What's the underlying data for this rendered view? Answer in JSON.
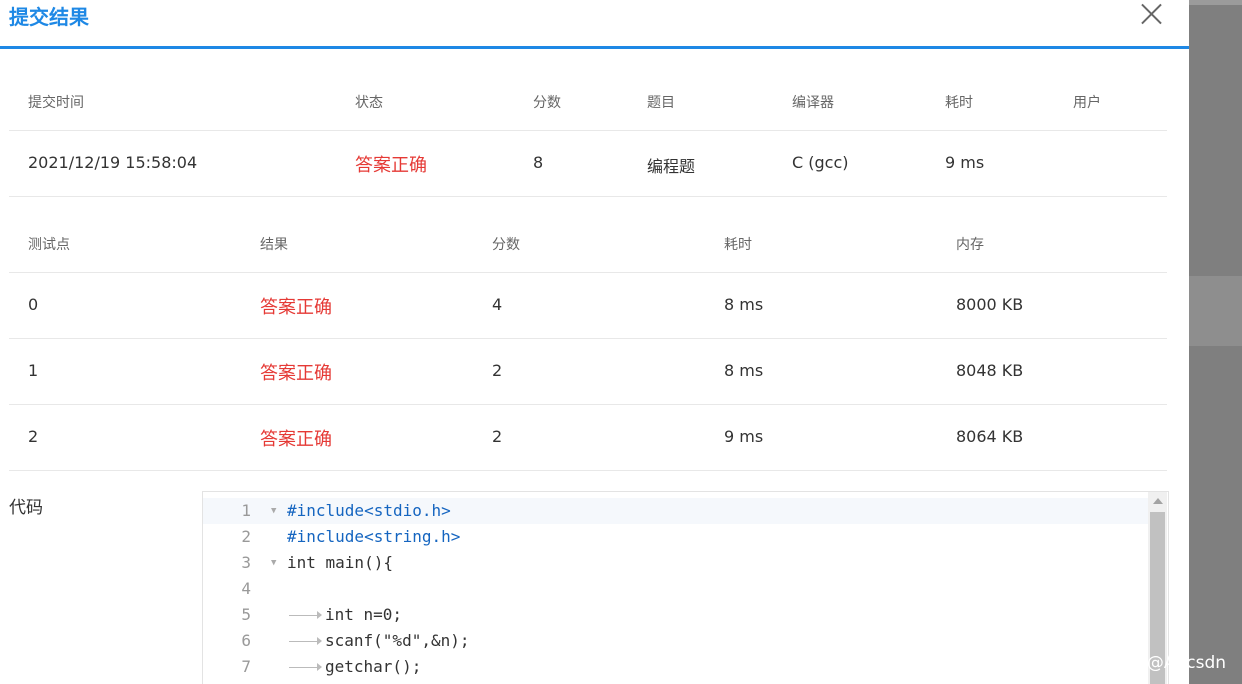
{
  "modal": {
    "title": "提交结果"
  },
  "summary": {
    "headers": [
      "提交时间",
      "状态",
      "分数",
      "题目",
      "编译器",
      "耗时",
      "用户"
    ],
    "row": [
      "2021/12/19 15:58:04",
      "答案正确",
      "8",
      "编程题",
      "C (gcc)",
      "9 ms",
      ""
    ]
  },
  "tests": {
    "headers": [
      "测试点",
      "结果",
      "分数",
      "耗时",
      "内存"
    ],
    "rows": [
      [
        "0",
        "答案正确",
        "4",
        "8 ms",
        "8000 KB"
      ],
      [
        "1",
        "答案正确",
        "2",
        "8 ms",
        "8048 KB"
      ],
      [
        "2",
        "答案正确",
        "2",
        "9 ms",
        "8064 KB"
      ]
    ]
  },
  "code": {
    "label": "代码",
    "line_numbers": [
      "1",
      "2",
      "3",
      "4",
      "5",
      "6",
      "7"
    ],
    "lines": [
      "#include<stdio.h>",
      "#include<string.h>",
      "int main(){",
      "",
      "int n=0;",
      "scanf(\"%d\",&n);",
      "getchar();"
    ]
  },
  "watermark": "CSDN @Agcsdn",
  "colors": {
    "accent": "#1e88e5",
    "status_ok": "#e53935",
    "overlay": "#7f7f7f"
  }
}
